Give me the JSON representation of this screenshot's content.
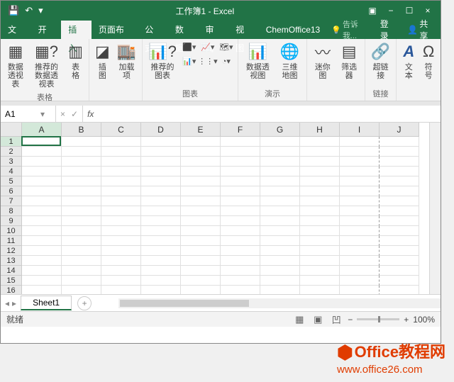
{
  "title": "工作簿1 - Excel",
  "qat": {
    "save": "💾",
    "undo": "↶",
    "dropdown": "▾"
  },
  "win": {
    "opts": "▣",
    "min": "−",
    "max": "☐",
    "close": "×"
  },
  "tabs": [
    "文件",
    "开始",
    "插入",
    "页面布局",
    "公式",
    "数据",
    "审阅",
    "视图",
    "ChemOffice13"
  ],
  "active_tab": "插入",
  "tell_me": "告诉我...",
  "login": "登录",
  "share": "共享",
  "ribbon": {
    "groups": [
      {
        "label": "表格",
        "items": [
          {
            "label": "数据透视表",
            "icon": "pivot"
          },
          {
            "label": "推荐的数据透视表",
            "icon": "pivot-rec"
          },
          {
            "label": "表格",
            "icon": "table"
          }
        ]
      },
      {
        "label": "",
        "items": [
          {
            "label": "插图",
            "icon": "shape"
          },
          {
            "label": "加载项",
            "icon": "addin"
          }
        ]
      },
      {
        "label": "图表",
        "items": [
          {
            "label": "推荐的图表",
            "icon": "chart-rec"
          }
        ]
      },
      {
        "label": "演示",
        "items": [
          {
            "label": "数据透视图",
            "icon": "pivot-chart"
          },
          {
            "label": "三维地图",
            "icon": "map3d"
          }
        ]
      },
      {
        "label": "",
        "items": [
          {
            "label": "迷你图",
            "icon": "spark"
          },
          {
            "label": "筛选器",
            "icon": "filter"
          }
        ]
      },
      {
        "label": "链接",
        "items": [
          {
            "label": "超链接",
            "icon": "link"
          }
        ]
      },
      {
        "label": "",
        "items": [
          {
            "label": "文本",
            "icon": "text"
          },
          {
            "label": "符号",
            "icon": "symbol"
          }
        ]
      }
    ]
  },
  "name_box": "A1",
  "formula": "",
  "columns": [
    "A",
    "B",
    "C",
    "D",
    "E",
    "F",
    "G",
    "H",
    "I",
    "J"
  ],
  "rows": [
    1,
    2,
    3,
    4,
    5,
    6,
    7,
    8,
    9,
    10,
    11,
    12,
    13,
    14,
    15,
    16
  ],
  "active_col": "A",
  "active_row": 1,
  "sheet": "Sheet1",
  "status": "就绪",
  "zoom": "100%",
  "watermark": {
    "line1": "Office教程网",
    "line2": "www.office26.com"
  }
}
